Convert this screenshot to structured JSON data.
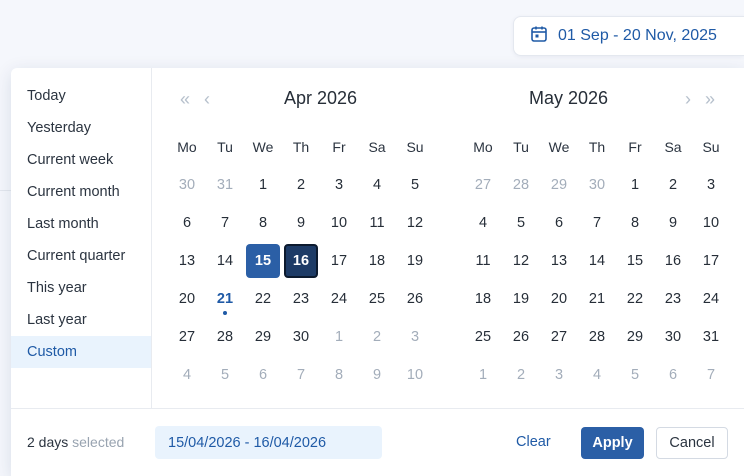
{
  "trigger": {
    "label": "01 Sep - 20 Nov, 2025",
    "icon": "calendar-icon"
  },
  "presets": [
    {
      "label": "Today",
      "active": false
    },
    {
      "label": "Yesterday",
      "active": false
    },
    {
      "label": "Current week",
      "active": false
    },
    {
      "label": "Current month",
      "active": false
    },
    {
      "label": "Last month",
      "active": false
    },
    {
      "label": "Current quarter",
      "active": false
    },
    {
      "label": "This year",
      "active": false
    },
    {
      "label": "Last year",
      "active": false
    },
    {
      "label": "Custom",
      "active": true
    }
  ],
  "calendar": {
    "weekdays": [
      "Mo",
      "Tu",
      "We",
      "Th",
      "Fr",
      "Sa",
      "Su"
    ],
    "nav": {
      "prev_year": "«",
      "prev_month": "‹",
      "next_month": "›",
      "next_year": "»"
    },
    "months": [
      {
        "title": "Apr 2026",
        "weeks": [
          [
            [
              "30",
              "muted"
            ],
            [
              "31",
              "muted"
            ],
            [
              "1",
              ""
            ],
            [
              "2",
              ""
            ],
            [
              "3",
              ""
            ],
            [
              "4",
              ""
            ],
            [
              "5",
              ""
            ]
          ],
          [
            [
              "6",
              ""
            ],
            [
              "7",
              ""
            ],
            [
              "8",
              ""
            ],
            [
              "9",
              ""
            ],
            [
              "10",
              ""
            ],
            [
              "11",
              ""
            ],
            [
              "12",
              ""
            ]
          ],
          [
            [
              "13",
              ""
            ],
            [
              "14",
              ""
            ],
            [
              "15",
              "sel-start"
            ],
            [
              "16",
              "sel-end"
            ],
            [
              "17",
              ""
            ],
            [
              "18",
              ""
            ],
            [
              "19",
              ""
            ]
          ],
          [
            [
              "20",
              ""
            ],
            [
              "21",
              "today"
            ],
            [
              "22",
              ""
            ],
            [
              "23",
              ""
            ],
            [
              "24",
              ""
            ],
            [
              "25",
              ""
            ],
            [
              "26",
              ""
            ]
          ],
          [
            [
              "27",
              ""
            ],
            [
              "28",
              ""
            ],
            [
              "29",
              ""
            ],
            [
              "30",
              ""
            ],
            [
              "1",
              "muted"
            ],
            [
              "2",
              "muted"
            ],
            [
              "3",
              "muted"
            ]
          ],
          [
            [
              "4",
              "muted"
            ],
            [
              "5",
              "muted"
            ],
            [
              "6",
              "muted"
            ],
            [
              "7",
              "muted"
            ],
            [
              "8",
              "muted"
            ],
            [
              "9",
              "muted"
            ],
            [
              "10",
              "muted"
            ]
          ]
        ]
      },
      {
        "title": "May 2026",
        "weeks": [
          [
            [
              "27",
              "muted"
            ],
            [
              "28",
              "muted"
            ],
            [
              "29",
              "muted"
            ],
            [
              "30",
              "muted"
            ],
            [
              "1",
              ""
            ],
            [
              "2",
              ""
            ],
            [
              "3",
              ""
            ]
          ],
          [
            [
              "4",
              ""
            ],
            [
              "5",
              ""
            ],
            [
              "6",
              ""
            ],
            [
              "7",
              ""
            ],
            [
              "8",
              ""
            ],
            [
              "9",
              ""
            ],
            [
              "10",
              ""
            ]
          ],
          [
            [
              "11",
              ""
            ],
            [
              "12",
              ""
            ],
            [
              "13",
              ""
            ],
            [
              "14",
              ""
            ],
            [
              "15",
              ""
            ],
            [
              "16",
              ""
            ],
            [
              "17",
              ""
            ]
          ],
          [
            [
              "18",
              ""
            ],
            [
              "19",
              ""
            ],
            [
              "20",
              ""
            ],
            [
              "21",
              ""
            ],
            [
              "22",
              ""
            ],
            [
              "23",
              ""
            ],
            [
              "24",
              ""
            ]
          ],
          [
            [
              "25",
              ""
            ],
            [
              "26",
              ""
            ],
            [
              "27",
              ""
            ],
            [
              "28",
              ""
            ],
            [
              "29",
              ""
            ],
            [
              "30",
              ""
            ],
            [
              "31",
              ""
            ]
          ],
          [
            [
              "1",
              "muted"
            ],
            [
              "2",
              "muted"
            ],
            [
              "3",
              "muted"
            ],
            [
              "4",
              "muted"
            ],
            [
              "5",
              "muted"
            ],
            [
              "6",
              "muted"
            ],
            [
              "7",
              "muted"
            ]
          ]
        ]
      }
    ]
  },
  "footer": {
    "count": "2 days",
    "count_suffix": "selected",
    "range_value": "15/04/2026 - 16/04/2026",
    "clear_label": "Clear",
    "apply_label": "Apply",
    "cancel_label": "Cancel"
  },
  "colors": {
    "accent": "#2b5fa6",
    "accent_dark": "#1d3b66",
    "preset_active_bg": "#e9f3fd"
  }
}
